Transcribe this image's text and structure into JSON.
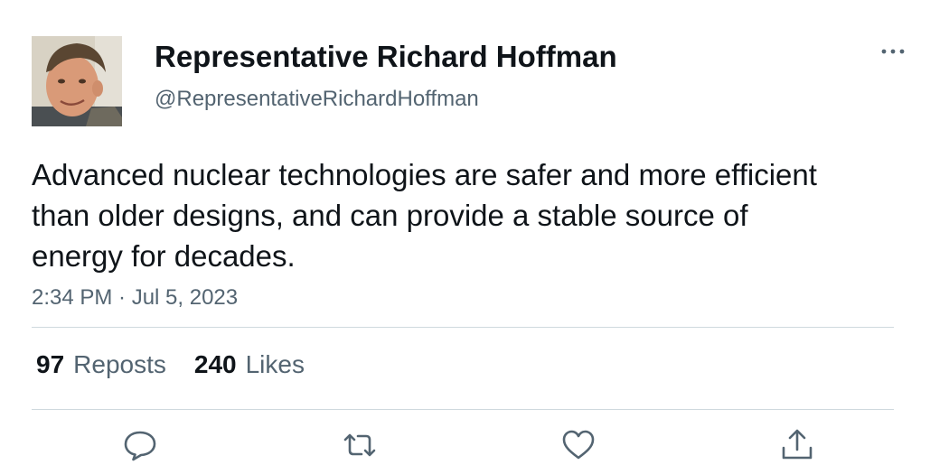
{
  "author": {
    "display_name": "Representative Richard Hoffman",
    "handle": "@RepresentativeRichardHoffman",
    "avatar_icon": "profile-photo"
  },
  "tweet": {
    "text": "Advanced nuclear technologies are safer and more efficient than older designs, and can provide a stable source of energy for decades.",
    "timestamp": "2:34 PM · Jul 5, 2023"
  },
  "stats": {
    "reposts_count": "97",
    "reposts_label": "Reposts",
    "likes_count": "240",
    "likes_label": "Likes"
  },
  "actions": [
    {
      "icon": "reply-icon"
    },
    {
      "icon": "repost-icon"
    },
    {
      "icon": "like-icon"
    },
    {
      "icon": "share-icon"
    }
  ],
  "colors": {
    "text_primary": "#0f1419",
    "text_secondary": "#536471",
    "divider": "#cfd9de",
    "background": "#ffffff"
  }
}
